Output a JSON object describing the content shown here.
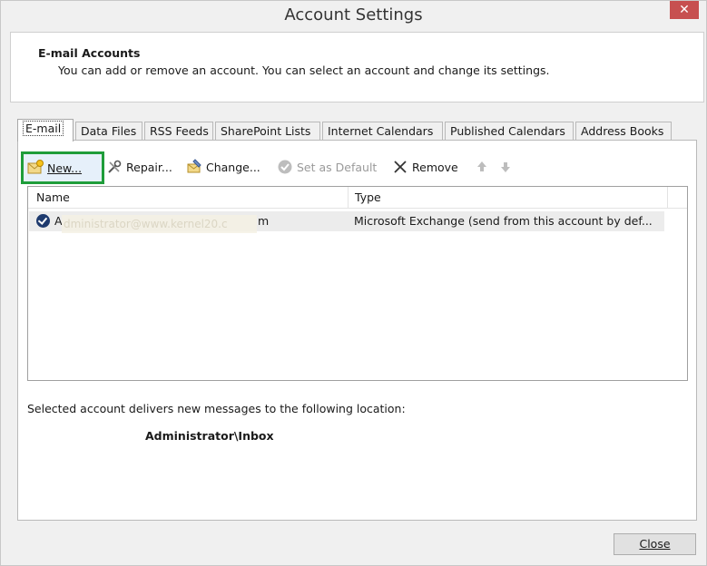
{
  "window": {
    "title": "Account Settings",
    "close_glyph": "✕"
  },
  "header": {
    "title": "E-mail Accounts",
    "description": "You can add or remove an account. You can select an account and change its settings."
  },
  "tabs": [
    {
      "label": "E-mail",
      "active": true
    },
    {
      "label": "Data Files"
    },
    {
      "label": "RSS Feeds"
    },
    {
      "label": "SharePoint Lists"
    },
    {
      "label": "Internet Calendars"
    },
    {
      "label": "Published Calendars"
    },
    {
      "label": "Address Books"
    }
  ],
  "toolbar": {
    "new_label": "New...",
    "repair_label": "Repair...",
    "change_label": "Change...",
    "set_default_label": "Set as Default",
    "remove_label": "Remove"
  },
  "list": {
    "col_name": "Name",
    "col_type": "Type",
    "rows": [
      {
        "name_prefix": "A",
        "name_obscured": "dministrator@www.kernel20.c",
        "name_suffix": "m",
        "type": "Microsoft Exchange (send from this account by def..."
      }
    ]
  },
  "delivery": {
    "label": "Selected account delivers new messages to the following location:",
    "location": "Administrator\\Inbox"
  },
  "footer": {
    "close_label": "Close"
  },
  "colors": {
    "highlight_border": "#1f9d3a",
    "close_window": "#c75050"
  }
}
